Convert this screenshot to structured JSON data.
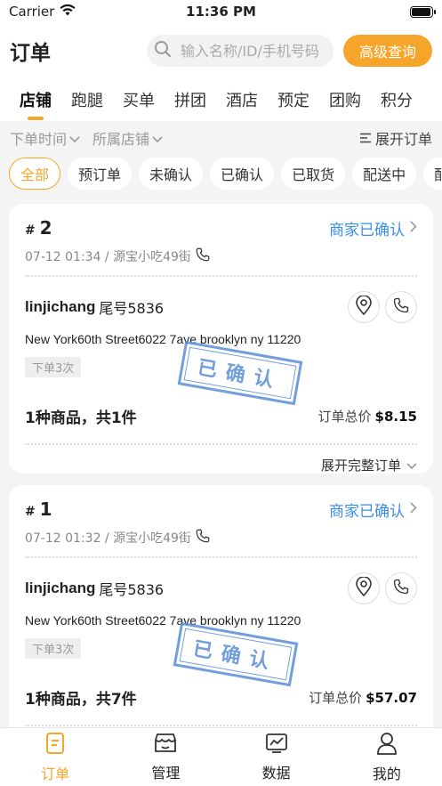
{
  "status_bar": {
    "carrier": "Carrier",
    "time": "11:36 PM",
    "battery_level": 0.95
  },
  "header": {
    "title": "订单",
    "search_placeholder": "输入名称/ID/手机号码",
    "advanced_search": "高级查询"
  },
  "category_tabs": [
    {
      "label": "店铺",
      "active": true
    },
    {
      "label": "跑腿"
    },
    {
      "label": "买单"
    },
    {
      "label": "拼团"
    },
    {
      "label": "酒店"
    },
    {
      "label": "预定"
    },
    {
      "label": "团购"
    },
    {
      "label": "积分"
    }
  ],
  "filters": {
    "order_time": "下单时间",
    "store": "所属店铺",
    "expand_orders": "展开订单"
  },
  "status_chips": [
    {
      "label": "全部",
      "active": true
    },
    {
      "label": "预订单"
    },
    {
      "label": "未确认"
    },
    {
      "label": "已确认"
    },
    {
      "label": "已取货"
    },
    {
      "label": "配送中"
    },
    {
      "label": "配"
    }
  ],
  "orders": [
    {
      "number": "2",
      "status": "商家已确认",
      "meta": "07-12 01:34 / 源宝小吃49街",
      "customer": "linjichang",
      "tail": "尾号5836",
      "address": "New York60th Street6022 7ave brooklyn ny 11220",
      "times": "下单3次",
      "stamp": "已确认",
      "summary": "1种商品，共1件",
      "total_label": "订单总价",
      "total": "$8.15",
      "expand": "展开完整订单"
    },
    {
      "number": "1",
      "status": "商家已确认",
      "meta": "07-12 01:32 / 源宝小吃49街",
      "customer": "linjichang",
      "tail": "尾号5836",
      "address": "New York60th Street6022 7ave brooklyn ny 11220",
      "times": "下单3次",
      "stamp": "已确认",
      "summary": "1种商品，共7件",
      "total_label": "订单总价",
      "total": "$57.07"
    }
  ],
  "tabbar": [
    {
      "label": "订单",
      "icon": "order-icon",
      "active": true
    },
    {
      "label": "管理",
      "icon": "manage-icon"
    },
    {
      "label": "数据",
      "icon": "data-icon"
    },
    {
      "label": "我的",
      "icon": "profile-icon"
    }
  ],
  "colors": {
    "accent": "#f5a52a",
    "link_blue": "#3a8ee6",
    "stamp_blue": "#5a8fd6"
  }
}
